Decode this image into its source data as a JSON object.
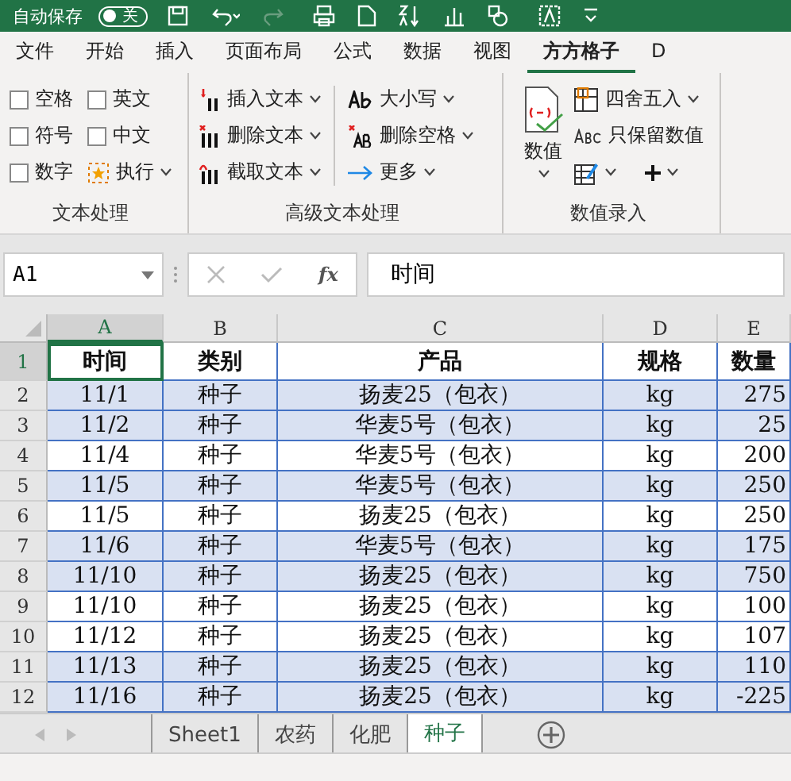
{
  "title_bar": {
    "autosave_label": "自动保存",
    "autosave_toggle": {
      "label": "关",
      "on": false
    }
  },
  "ribbon_tabs": [
    {
      "label": "文件",
      "selected": false
    },
    {
      "label": "开始",
      "selected": false
    },
    {
      "label": "插入",
      "selected": false
    },
    {
      "label": "页面布局",
      "selected": false
    },
    {
      "label": "公式",
      "selected": false
    },
    {
      "label": "数据",
      "selected": false
    },
    {
      "label": "视图",
      "selected": false
    },
    {
      "label": "方方格子",
      "selected": true
    },
    {
      "label": "D",
      "selected": false
    }
  ],
  "ribbon_groups": [
    {
      "label": "文本处理",
      "kind": "checks",
      "items": [
        {
          "kind": "checkbox",
          "label": "空格",
          "checked": false
        },
        {
          "kind": "checkbox",
          "label": "英文",
          "checked": false
        },
        {
          "kind": "checkbox",
          "label": "符号",
          "checked": false
        },
        {
          "kind": "checkbox",
          "label": "中文",
          "checked": false
        },
        {
          "kind": "checkbox",
          "label": "数字",
          "checked": false
        },
        {
          "kind": "button",
          "label": "执行"
        }
      ]
    },
    {
      "label": "高级文本处理",
      "kind": "columns",
      "columns": [
        [
          {
            "label": "插入文本"
          },
          {
            "label": "删除文本"
          },
          {
            "label": "截取文本"
          }
        ],
        [
          {
            "label": "大小写"
          },
          {
            "label": "删除空格"
          },
          {
            "label": "更多"
          }
        ]
      ]
    },
    {
      "label": "数值录入",
      "kind": "numbers",
      "big": "数值",
      "items": [
        {
          "label": "四舍五入"
        },
        {
          "label": "只保留数值"
        }
      ]
    }
  ],
  "formula_bar": {
    "name_box": "A1",
    "fx": "fx",
    "value": "时间"
  },
  "sheet": {
    "columns": [
      {
        "label": "A",
        "selected": true
      },
      {
        "label": "B",
        "selected": false
      },
      {
        "label": "C",
        "selected": false
      },
      {
        "label": "D",
        "selected": false
      },
      {
        "label": "E",
        "selected": false
      }
    ],
    "header_row": {
      "number": "1",
      "cells": [
        "时间",
        "类别",
        "产品",
        "规格",
        "数量"
      ]
    },
    "rows": [
      {
        "number": "2",
        "highlighted": true,
        "cells": [
          "11/1",
          "种子",
          "扬麦25（包衣）",
          "kg",
          "275"
        ]
      },
      {
        "number": "3",
        "highlighted": true,
        "cells": [
          "11/2",
          "种子",
          "华麦5号（包衣）",
          "kg",
          "25"
        ]
      },
      {
        "number": "4",
        "highlighted": false,
        "cells": [
          "11/4",
          "种子",
          "华麦5号（包衣）",
          "kg",
          "200"
        ]
      },
      {
        "number": "5",
        "highlighted": true,
        "cells": [
          "11/5",
          "种子",
          "华麦5号（包衣）",
          "kg",
          "250"
        ]
      },
      {
        "number": "6",
        "highlighted": false,
        "cells": [
          "11/5",
          "种子",
          "扬麦25（包衣）",
          "kg",
          "250"
        ]
      },
      {
        "number": "7",
        "highlighted": true,
        "cells": [
          "11/6",
          "种子",
          "华麦5号（包衣）",
          "kg",
          "175"
        ]
      },
      {
        "number": "8",
        "highlighted": true,
        "cells": [
          "11/10",
          "种子",
          "扬麦25（包衣）",
          "kg",
          "750"
        ]
      },
      {
        "number": "9",
        "highlighted": false,
        "cells": [
          "11/10",
          "种子",
          "扬麦25（包衣）",
          "kg",
          "100"
        ]
      },
      {
        "number": "10",
        "highlighted": false,
        "cells": [
          "11/12",
          "种子",
          "扬麦25（包衣）",
          "kg",
          "107"
        ]
      },
      {
        "number": "11",
        "highlighted": true,
        "cells": [
          "11/13",
          "种子",
          "扬麦25（包衣）",
          "kg",
          "110"
        ]
      },
      {
        "number": "12",
        "highlighted": true,
        "cells": [
          "11/16",
          "种子",
          "扬麦25（包衣）",
          "kg",
          "-225"
        ]
      }
    ]
  },
  "sheet_tabs": [
    {
      "label": "Sheet1",
      "selected": false
    },
    {
      "label": "农药",
      "selected": false
    },
    {
      "label": "化肥",
      "selected": false
    },
    {
      "label": "种子",
      "selected": true
    }
  ]
}
